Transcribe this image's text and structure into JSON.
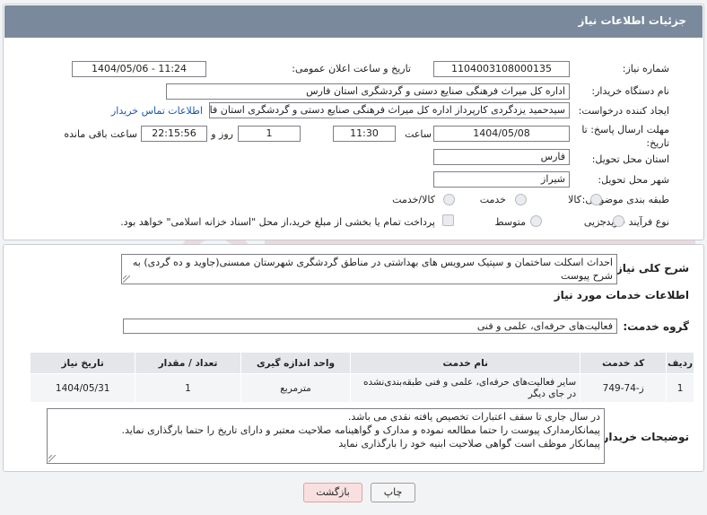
{
  "header": {
    "title": "جزئیات اطلاعات نیاز"
  },
  "fields": {
    "need_number_label": "شماره نیاز:",
    "need_number": "1104003108000135",
    "announce_label": "تاریخ و ساعت اعلان عمومی:",
    "announce_value": "1404/05/06 - 11:24",
    "buyer_org_label": "نام دستگاه خریدار:",
    "buyer_org": "اداره کل میراث فرهنگی  صنایع دستی و گردشگری استان فارس",
    "creator_label": "ایجاد کننده درخواست:",
    "creator": "سیدحمید یزدگردی کارپرداز اداره کل میراث فرهنگی  صنایع دستی و گردشگری استان فارس",
    "contact_link": "اطلاعات تماس خریدار",
    "deadline_label": "مهلت ارسال پاسخ: تا تاریخ:",
    "deadline_date": "1404/05/08",
    "time_label": "ساعت",
    "deadline_time": "11:30",
    "days_value": "1",
    "days_label": "روز و",
    "remaining_time": "22:15:56",
    "remaining_label": "ساعت باقی مانده",
    "province_label": "استان محل تحویل:",
    "province": "فارس",
    "city_label": "شهر محل تحویل:",
    "city": "شیراز",
    "category_label": "طبقه بندی موضوعی:",
    "category_options": [
      "کالا",
      "خدمت",
      "کالا/خدمت"
    ],
    "purchase_type_label": "نوع فرآیند خرید :",
    "purchase_options": [
      "جزیی",
      "متوسط"
    ],
    "payment_note": "پرداخت تمام یا بخشی از مبلغ خرید،از محل \"اسناد خزانه اسلامی\" خواهد بود."
  },
  "description": {
    "label": "شرح کلی نیاز:",
    "text": "احداث اسکلت ساختمان و سپتیک سرویس های بهداشتی در مناطق گردشگری شهرستان ممسنی(جاوید و ده گردی) به شرح پیوست"
  },
  "services": {
    "section_title": "اطلاعات خدمات مورد نیاز",
    "group_label": "گروه خدمت:",
    "group_value": "فعالیت‌های حرفه‌ای، علمی و فنی",
    "columns": [
      "ردیف",
      "کد خدمت",
      "نام خدمت",
      "واحد اندازه گیری",
      "تعداد / مقدار",
      "تاریخ نیاز"
    ],
    "rows": [
      {
        "index": "1",
        "code": "ز-74-749",
        "name": "سایر فعالیت‌های حرفه‌ای، علمی و فنی طبقه‌بندی‌نشده در جای دیگر",
        "unit": "مترمربع",
        "qty": "1",
        "date": "1404/05/31"
      }
    ]
  },
  "buyer_notes": {
    "label": "توضیحات خریدار:",
    "lines": [
      "در سال جاری تا سقف اعتبارات تخصیص یافته نقدی می باشد.",
      "پیمانکارمدارک پیوست را حتما مطالعه نموده و مدارک و گواهینامه صلاحیت معتبر و دارای تاریخ را حتما بارگذاری نماید.",
      "پیمانکار موظف است گواهی صلاحیت ابنیه خود را بارگذاری نماید"
    ]
  },
  "buttons": {
    "print": "چاپ",
    "back": "بازگشت"
  },
  "colors": {
    "header": "#7a8a9c",
    "link": "#1a56b0",
    "back_button": "#f9e0e0"
  }
}
